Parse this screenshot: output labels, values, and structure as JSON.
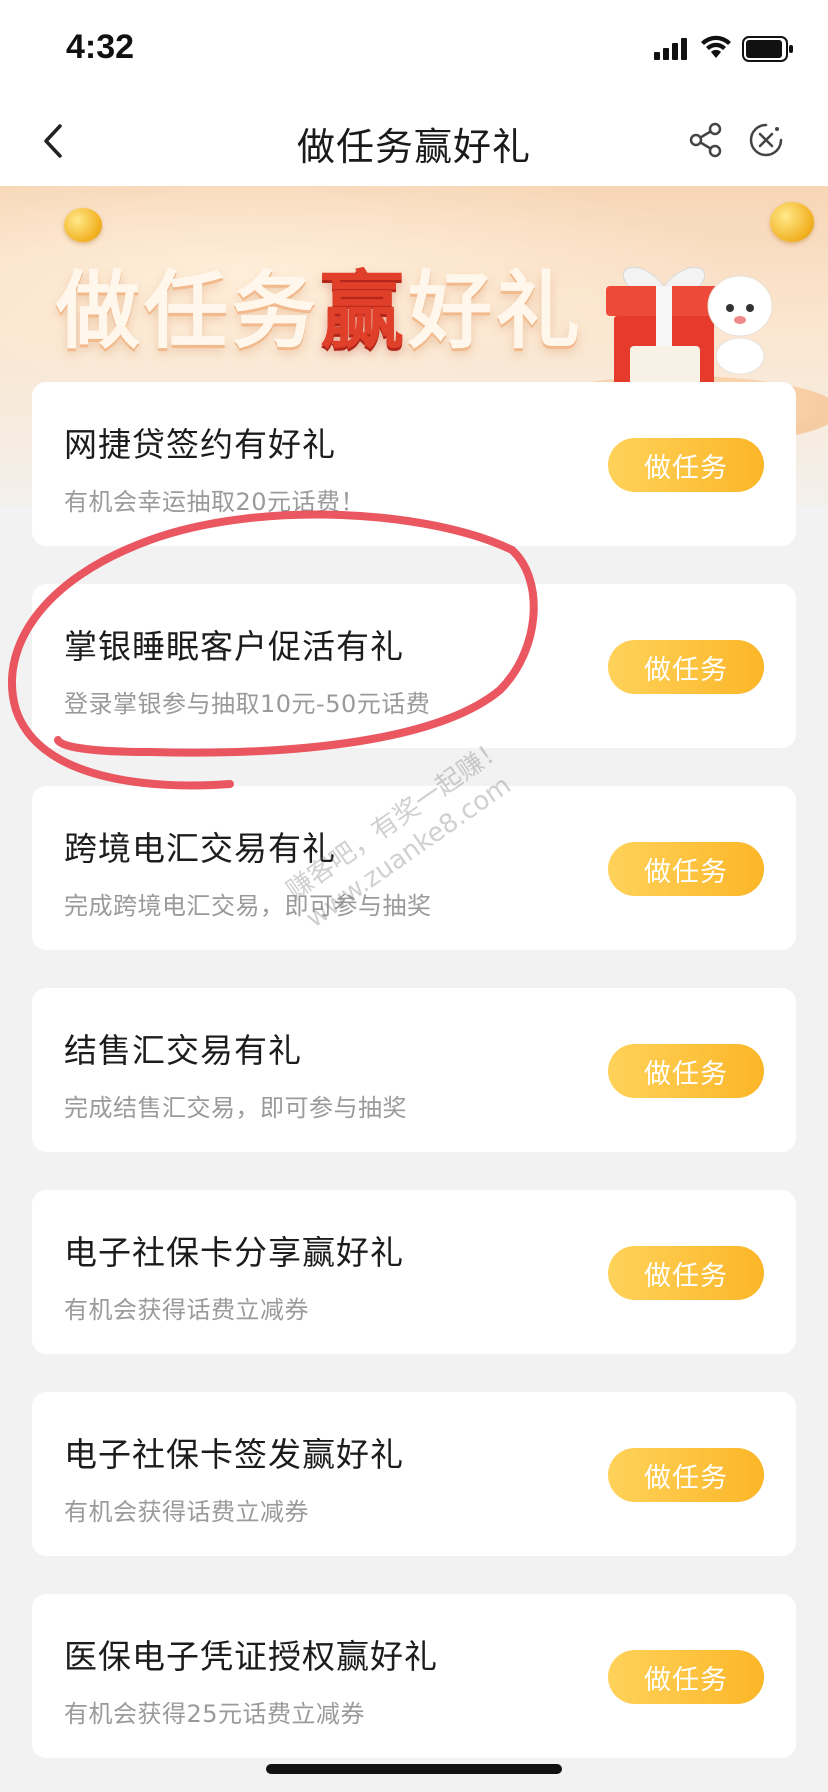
{
  "status_bar": {
    "time": "4:32",
    "icons": [
      "signal-icon",
      "wifi-icon",
      "battery-icon"
    ]
  },
  "nav": {
    "title": "做任务赢好礼",
    "icons": [
      "back-icon",
      "share-icon",
      "close-icon"
    ]
  },
  "banner": {
    "title_part1": "做任务",
    "title_highlight": "赢",
    "title_part2": "好礼",
    "highlight_color": "#e0402a"
  },
  "tasks": [
    {
      "title": "网捷贷签约有好礼",
      "desc": "有机会幸运抽取20元话费！",
      "button": "做任务"
    },
    {
      "title": "掌银睡眠客户促活有礼",
      "desc": "登录掌银参与抽取10元-50元话费",
      "button": "做任务"
    },
    {
      "title": "跨境电汇交易有礼",
      "desc": "完成跨境电汇交易，即可参与抽奖",
      "button": "做任务"
    },
    {
      "title": "结售汇交易有礼",
      "desc": "完成结售汇交易，即可参与抽奖",
      "button": "做任务"
    },
    {
      "title": "电子社保卡分享赢好礼",
      "desc": "有机会获得话费立减券",
      "button": "做任务"
    },
    {
      "title": "电子社保卡签发赢好礼",
      "desc": "有机会获得话费立减券",
      "button": "做任务"
    },
    {
      "title": "医保电子凭证授权赢好礼",
      "desc": "有机会获得25元话费立减券",
      "button": "做任务"
    }
  ],
  "watermark": {
    "line1": "赚客吧，有奖一起赚！",
    "line2": "www.zuanke8.com"
  },
  "colors": {
    "button_gradient_start": "#ffd25a",
    "button_gradient_end": "#fbb628",
    "annotation": "#e8454f"
  }
}
